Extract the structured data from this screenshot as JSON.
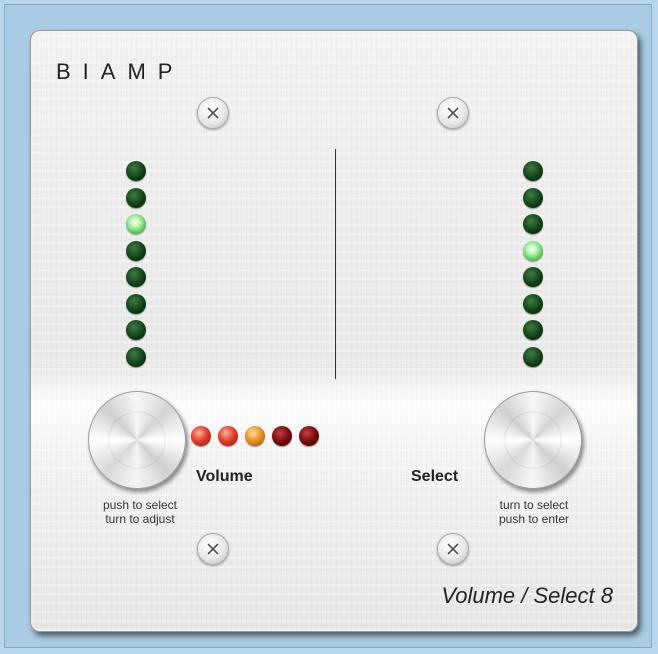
{
  "brand": {
    "logo_text": "BIAMP"
  },
  "model_name": "Volume / Select 8",
  "left_control": {
    "label": "Volume",
    "caption_line1": "push to select",
    "caption_line2": "turn to adjust",
    "level_leds": [
      "off",
      "off",
      "on",
      "off",
      "off",
      "off",
      "off",
      "off"
    ],
    "indicator_leds": [
      "red-on",
      "red-on",
      "amber-on",
      "red-off",
      "red-off"
    ]
  },
  "right_control": {
    "label": "Select",
    "caption_line1": "turn to select",
    "caption_line2": "push to enter",
    "level_leds": [
      "off",
      "off",
      "off",
      "on",
      "off",
      "off",
      "off",
      "off"
    ]
  },
  "colors": {
    "background": "#b9d6ea",
    "led_green_off": "#0b3d12",
    "led_green_on": "#4fc14a",
    "led_red": "#e0402a",
    "led_amber": "#e8922a"
  },
  "icons": [
    "screw-icon"
  ]
}
